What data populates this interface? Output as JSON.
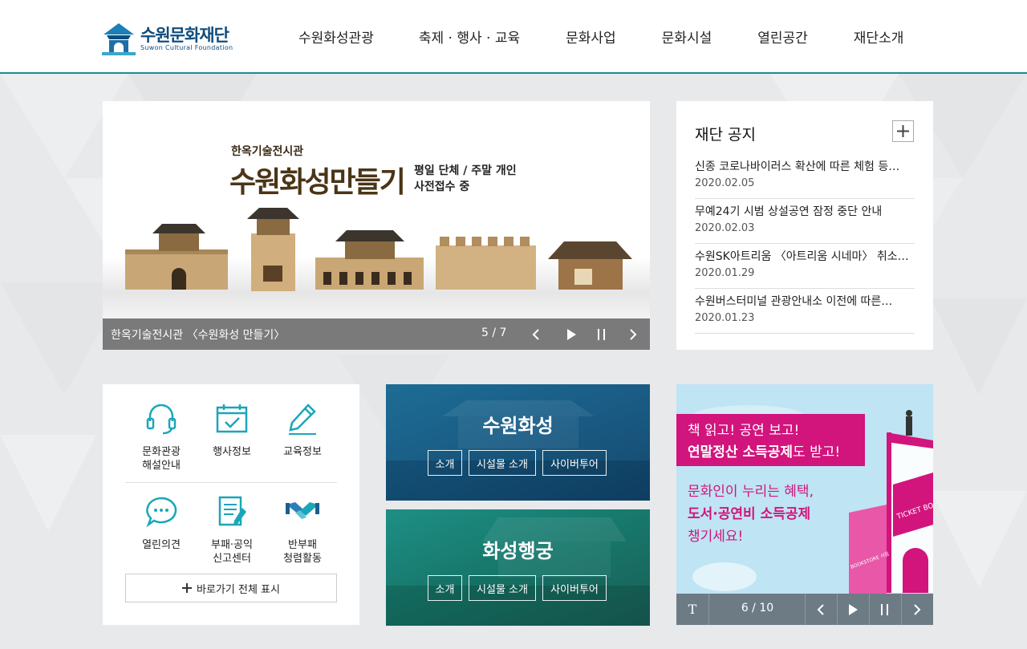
{
  "header": {
    "logo_ko": "수원문화재단",
    "logo_en": "Suwon Cultural Foundation",
    "nav": [
      "수원화성관광",
      "축제 · 행사 · 교육",
      "문화사업",
      "문화시설",
      "열린공간",
      "재단소개"
    ]
  },
  "visual": {
    "sub_title": "한옥기술전시관",
    "title": "수원화성만들기",
    "note_line1": "평일 단체 / 주말 개인",
    "note_line2": "사전접수 중",
    "caption": "한옥기술전시관 〈수원화성 만들기〉",
    "counter": "5 / 7",
    "controls": [
      "prev-icon",
      "play-icon",
      "pause-icon",
      "next-icon"
    ]
  },
  "notice": {
    "title": "재단 공지",
    "items": [
      {
        "title": "신종 코로나바이러스 확산에 따른 체험 등…",
        "date": "2020.02.05"
      },
      {
        "title": "무예24기 시범 상설공연 잠정 중단 안내",
        "date": "2020.02.03"
      },
      {
        "title": "수원SK아트리움 〈아트리움 시네마〉 취소…",
        "date": "2020.01.29"
      },
      {
        "title": "수원버스터미널 관광안내소 이전에 따른…",
        "date": "2020.01.23"
      }
    ]
  },
  "quick": {
    "items": [
      {
        "line1": "문화관광",
        "line2": "해설안내",
        "icon": "headset-icon"
      },
      {
        "line1": "행사정보",
        "line2": "",
        "icon": "calendar-check-icon"
      },
      {
        "line1": "교육정보",
        "line2": "",
        "icon": "pencil-icon"
      },
      {
        "line1": "열린의견",
        "line2": "",
        "icon": "speech-bubble-icon"
      },
      {
        "line1": "부패·공익",
        "line2": "신고센터",
        "icon": "document-icon"
      },
      {
        "line1": "반부패",
        "line2": "청렴활동",
        "icon": "handshake-icon"
      }
    ],
    "show_all": "바로가기 전체 표시"
  },
  "cards": [
    {
      "title": "수원화성",
      "buttons": [
        "소개",
        "시설물 소개",
        "사이버투어"
      ]
    },
    {
      "title": "화성행궁",
      "buttons": [
        "소개",
        "시설물 소개",
        "사이버투어"
      ]
    }
  ],
  "banner": {
    "line1a": "책 읽고! 공연 보고!",
    "line1b_bold": "연말정산 소득공제",
    "line1b_rest": "도 받고!",
    "line2": "문화인이 누리는 혜택,",
    "line3": "도서·공연비 소득공제",
    "line4": "챙기세요!",
    "sign_ticket": "TICKET BO",
    "sign_bookstore": "BOOKSTORE 서점",
    "text_toggle": "T",
    "counter": "6 / 10"
  },
  "colors": {
    "accent": "#1e8c8e",
    "brand": "#0f4d7e",
    "banner_pink": "#d2147d"
  }
}
